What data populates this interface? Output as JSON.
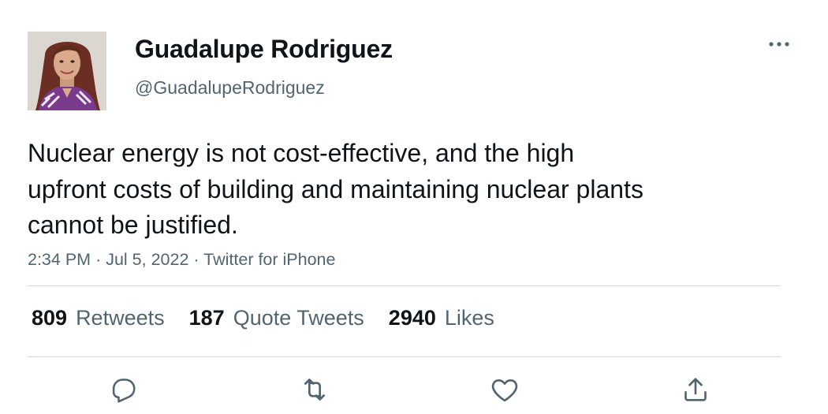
{
  "author": {
    "display_name": "Guadalupe Rodriguez",
    "handle": "@GuadalupeRodriguez"
  },
  "tweet": {
    "text": "Nuclear energy is not cost-effective, and the high upfront costs of building and maintaining nuclear plants cannot be justified.",
    "time": "2:34 PM",
    "date": "Jul 5, 2022",
    "source": "Twitter for iPhone",
    "separator": "·"
  },
  "stats": {
    "retweets": {
      "count": "809",
      "label": "Retweets"
    },
    "quote_tweets": {
      "count": "187",
      "label": "Quote Tweets"
    },
    "likes": {
      "count": "2940",
      "label": "Likes"
    }
  },
  "icons": {
    "more": "more-horizontal-icon",
    "reply": "reply-icon",
    "retweet": "retweet-icon",
    "like": "heart-icon",
    "share": "share-icon"
  },
  "colors": {
    "text_primary": "#0f1419",
    "text_secondary": "#536471",
    "divider": "#cfd9de",
    "icon": "#536471"
  }
}
